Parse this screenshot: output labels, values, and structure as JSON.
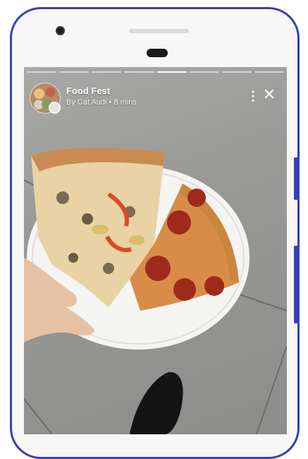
{
  "story": {
    "title": "Food Fest",
    "author_line": "By Cat Audi • 8 mins",
    "segments_total": 8,
    "active_segment": 4
  },
  "icons": {
    "menu": "more-vertical-icon",
    "close": "close-icon",
    "avatar": "profile-avatar"
  },
  "colors": {
    "frame": "#3540b8",
    "overlay_text": "#ffffff",
    "progress_track": "rgba(255,255,255,0.55)",
    "progress_active": "#ffffff"
  },
  "glyphs": {
    "menu": "⋮",
    "close": "✕"
  }
}
